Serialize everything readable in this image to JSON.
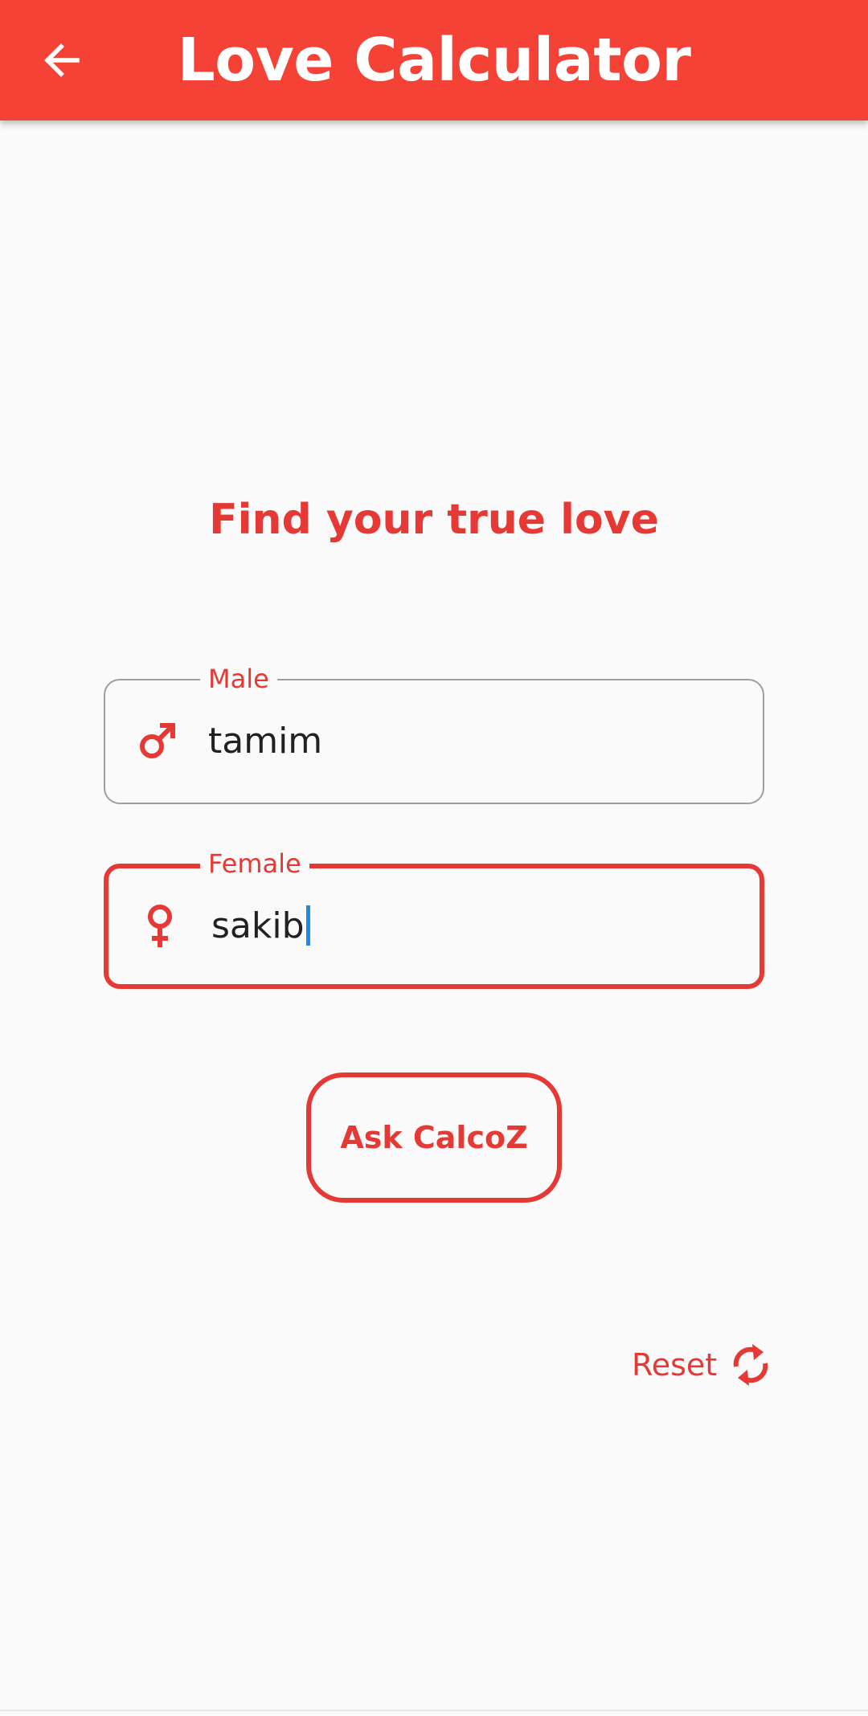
{
  "app_bar": {
    "title": "Love Calculator",
    "back_icon": "arrow-left-icon",
    "color": "#f44336"
  },
  "main": {
    "headline": "Find your true love",
    "male_field": {
      "label": "Male",
      "value": "tamim",
      "icon": "male-symbol-icon"
    },
    "female_field": {
      "label": "Female",
      "value": "sakib",
      "icon": "female-symbol-icon",
      "focused": true
    },
    "ask_button_label": "Ask CalcoZ",
    "reset": {
      "label": "Reset",
      "icon": "refresh-icon"
    }
  },
  "colors": {
    "accent": "#e53935",
    "background": "#fafafa",
    "caret": "#1e88e5"
  }
}
